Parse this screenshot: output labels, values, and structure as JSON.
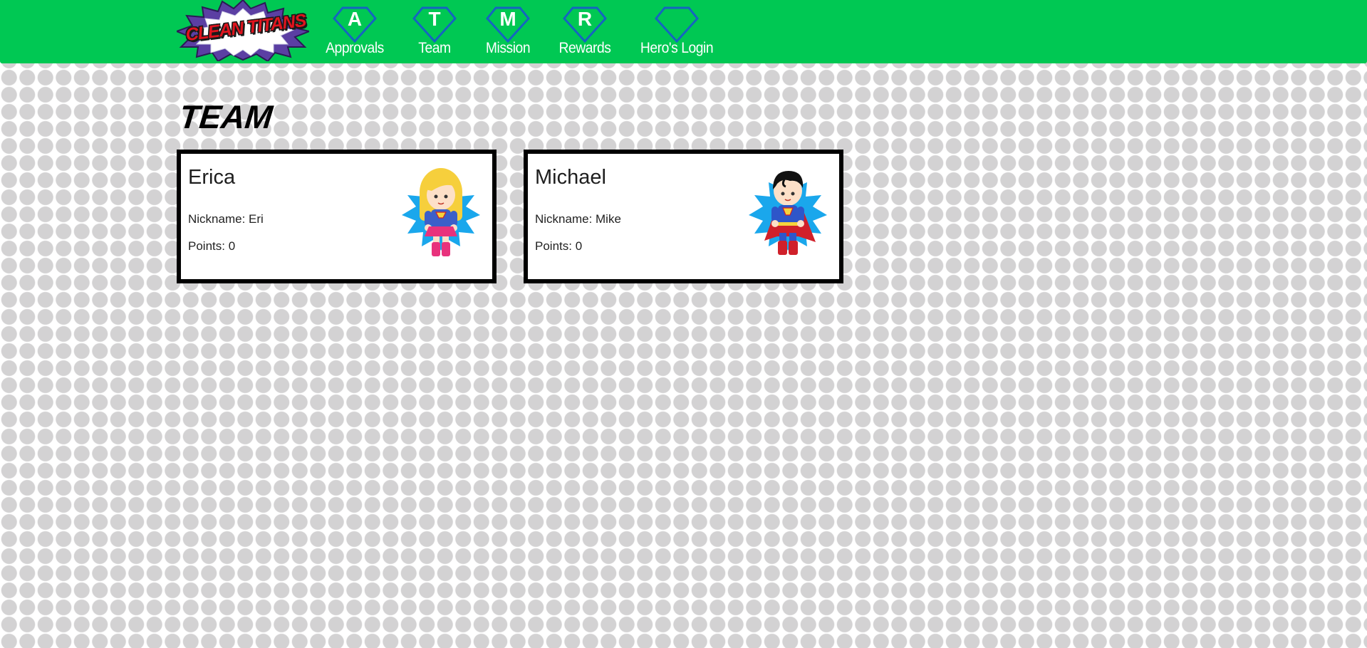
{
  "brand": {
    "logo_text": "CLEAN TITANS",
    "colors": {
      "nav_bg": "#00c853",
      "gem_stroke": "#1565c0",
      "gem_fill": "#00c853",
      "logo_text": "#e0141e",
      "logo_burst": "#5b3fa3"
    }
  },
  "nav": {
    "items": [
      {
        "letter": "A",
        "label": "Approvals"
      },
      {
        "letter": "T",
        "label": "Team"
      },
      {
        "letter": "M",
        "label": "Mission"
      },
      {
        "letter": "R",
        "label": "Rewards"
      },
      {
        "letter": "",
        "label": "Hero's Login"
      }
    ]
  },
  "page": {
    "title": "TEAM"
  },
  "team": [
    {
      "name": "Erica",
      "nickname": "Nickname: Eri",
      "points": "Points: 0",
      "avatar_icon": "supergirl-icon"
    },
    {
      "name": "Michael",
      "nickname": "Nickname: Mike",
      "points": "Points: 0",
      "avatar_icon": "superman-icon"
    }
  ]
}
